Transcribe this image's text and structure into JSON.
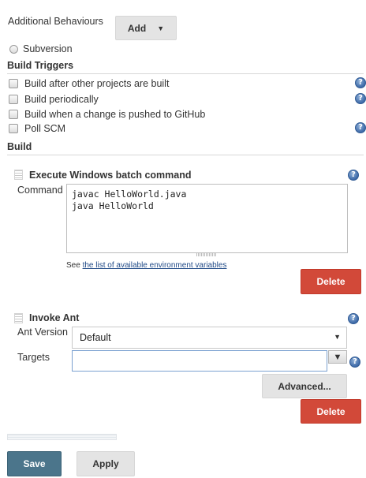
{
  "scm": {
    "additional_behaviours_label": "Additional Behaviours",
    "add_button_label": "Add",
    "subversion_label": "Subversion"
  },
  "build_triggers": {
    "title": "Build Triggers",
    "items": [
      {
        "label": "Build after other projects are built",
        "has_help": true
      },
      {
        "label": "Build periodically",
        "has_help": true
      },
      {
        "label": "Build when a change is pushed to GitHub",
        "has_help": false
      },
      {
        "label": "Poll SCM",
        "has_help": true
      }
    ]
  },
  "build": {
    "title": "Build",
    "windows_batch": {
      "title": "Execute Windows batch command",
      "command_label": "Command",
      "command_value": "javac HelloWorld.java\njava HelloWorld",
      "env_see": "See",
      "env_link": "the list of available environment variables",
      "delete_label": "Delete"
    },
    "invoke_ant": {
      "title": "Invoke Ant",
      "ant_version_label": "Ant Version",
      "ant_version_value": "Default",
      "targets_label": "Targets",
      "targets_value": "",
      "advanced_label": "Advanced...",
      "delete_label": "Delete"
    }
  },
  "footer": {
    "save_label": "Save",
    "apply_label": "Apply"
  },
  "colors": {
    "delete": "#d24939",
    "save": "#4b758b",
    "help": "#3e6aa8"
  }
}
